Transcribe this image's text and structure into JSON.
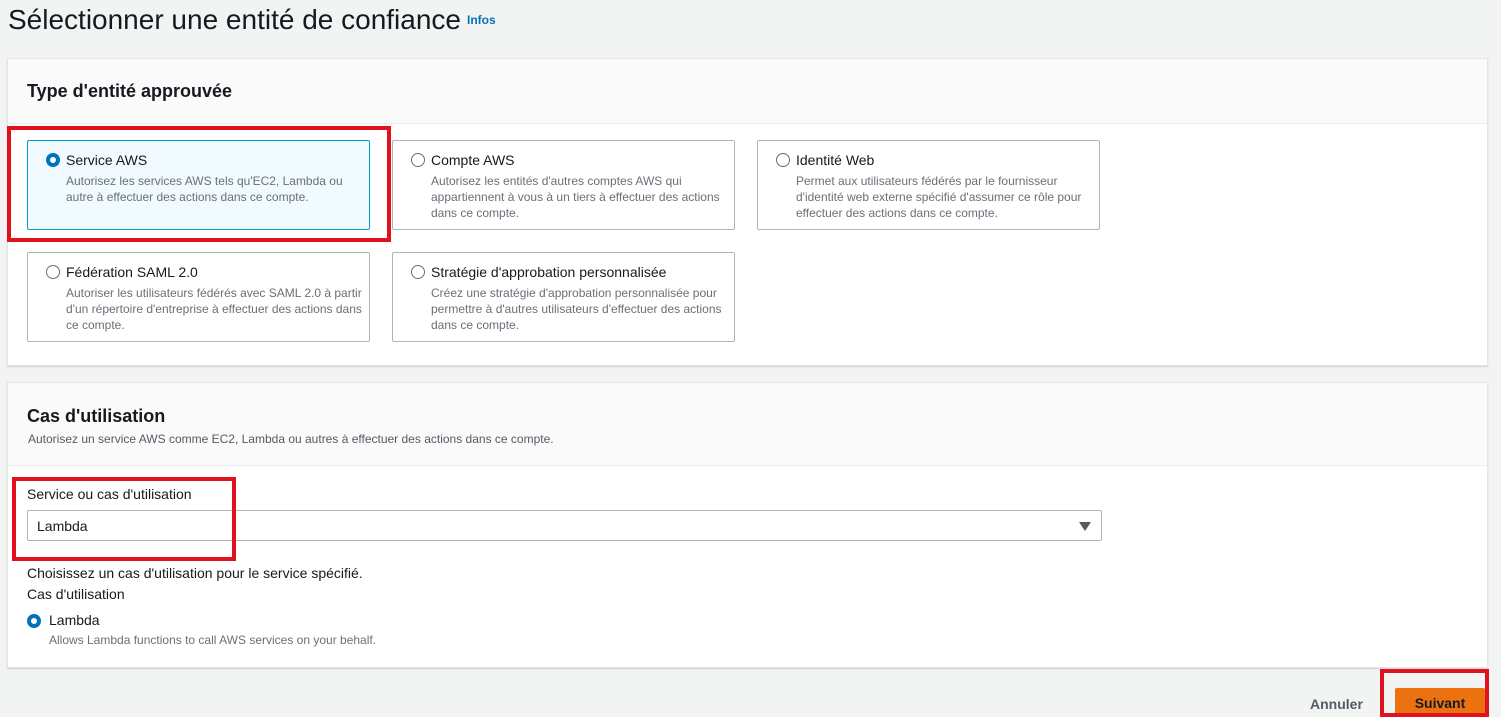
{
  "header": {
    "title": "Sélectionner une entité de confiance",
    "info_link": "Infos"
  },
  "entity_type": {
    "heading": "Type d'entité approuvée",
    "options": [
      {
        "label": "Service AWS",
        "description": "Autorisez les services AWS tels qu'EC2, Lambda ou autre à effectuer des actions dans ce compte.",
        "selected": true
      },
      {
        "label": "Compte AWS",
        "description": "Autorisez les entités d'autres comptes AWS qui appartiennent à vous à un tiers à effectuer des actions dans ce compte.",
        "selected": false
      },
      {
        "label": "Identité Web",
        "description": "Permet aux utilisateurs fédérés par le fournisseur d'identité web externe spécifié d'assumer ce rôle pour effectuer des actions dans ce compte.",
        "selected": false
      },
      {
        "label": "Fédération SAML 2.0",
        "description": "Autoriser les utilisateurs fédérés avec SAML 2.0 à partir d'un répertoire d'entreprise à effectuer des actions dans ce compte.",
        "selected": false
      },
      {
        "label": "Stratégie d'approbation personnalisée",
        "description": "Créez une stratégie d'approbation personnalisée pour permettre à d'autres utilisateurs d'effectuer des actions dans ce compte.",
        "selected": false
      }
    ]
  },
  "use_case": {
    "heading": "Cas d'utilisation",
    "description": "Autorisez un service AWS comme EC2, Lambda ou autres à effectuer des actions dans ce compte.",
    "field_label": "Service ou cas d'utilisation",
    "selected_value": "Lambda",
    "hint": "Choisissez un cas d'utilisation pour le service spécifié.",
    "use_case_label": "Cas d'utilisation",
    "option": {
      "label": "Lambda",
      "description": "Allows Lambda functions to call AWS services on your behalf.",
      "selected": true
    }
  },
  "actions": {
    "cancel": "Annuler",
    "next": "Suivant"
  },
  "colors": {
    "accent": "#0073bb",
    "primary_button": "#ec7211",
    "highlight": "#e0121e"
  }
}
